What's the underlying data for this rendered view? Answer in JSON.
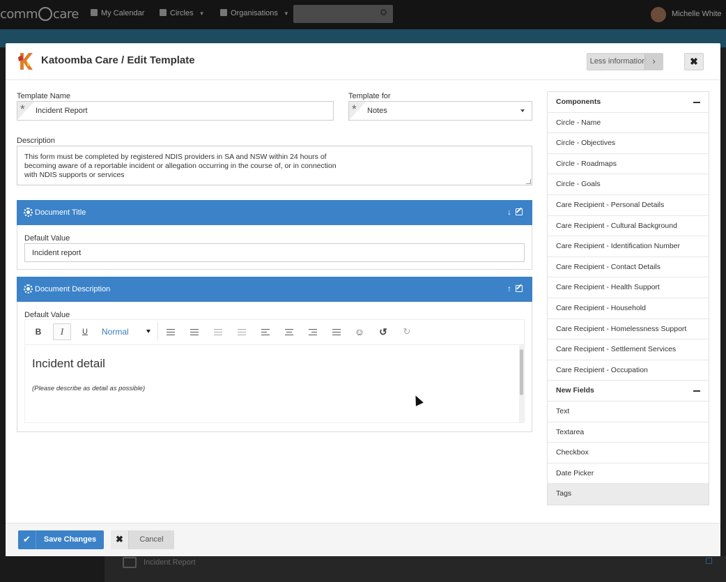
{
  "background": {
    "logo": "comm",
    "logo_suffix": "care",
    "nav": [
      {
        "label": "My Calendar",
        "icon": "calendar-icon"
      },
      {
        "label": "Circles",
        "icon": "people-icon"
      },
      {
        "label": "Organisations",
        "icon": "building-icon"
      }
    ],
    "user_name": "Michelle White",
    "behind_row": "Incident Report"
  },
  "modal": {
    "title": "Katoomba Care / Edit Template",
    "less_info_label": "Less information",
    "close_glyph": "✖"
  },
  "form": {
    "template_name_label": "Template Name",
    "template_name_value": "Incident Report",
    "template_for_label": "Template for",
    "template_for_value": "Notes",
    "description_label": "Description",
    "description_value": "This form must be completed by registered NDIS providers in SA and NSW within 24 hours of\nbecoming aware of a reportable incident or allegation occurring in the course of, or in connection\nwith NDIS supports or services"
  },
  "panels": {
    "doc_title": {
      "header": "Document Title",
      "default_label": "Default Value",
      "default_value": "Incident report"
    },
    "doc_description": {
      "header": "Document Description",
      "default_label": "Default Value",
      "format": "Normal",
      "heading": "Incident detail",
      "body": "(Please describe as detail as possible)"
    }
  },
  "sidebar": {
    "components_header": "Components",
    "components": [
      "Circle - Name",
      "Circle - Objectives",
      "Circle - Roadmaps",
      "Circle - Goals",
      "Care Recipient - Personal Details",
      "Care Recipient - Cultural Background",
      "Care Recipient - Identification Number",
      "Care Recipient - Contact Details",
      "Care Recipient - Health Support",
      "Care Recipient - Household",
      "Care Recipient - Homelessness Support",
      "Care Recipient - Settlement Services",
      "Care Recipient - Occupation"
    ],
    "new_fields_header": "New Fields",
    "new_fields": [
      "Text",
      "Textarea",
      "Checkbox",
      "Date Picker",
      "Tags"
    ]
  },
  "footer": {
    "save_label": "Save Changes",
    "cancel_label": "Cancel"
  },
  "colors": {
    "accent": "#3b82c8",
    "header_bg": "#141414"
  }
}
